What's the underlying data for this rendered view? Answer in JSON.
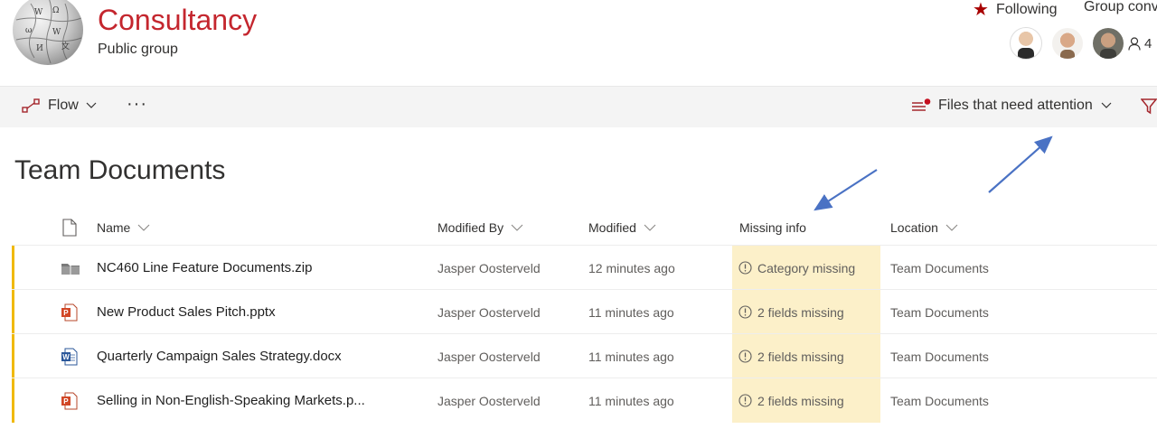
{
  "site": {
    "title": "Consultancy",
    "subtitle": "Public group",
    "following_label": "Following",
    "group_conversations_label": "Group conve",
    "member_count": "4"
  },
  "commandbar": {
    "flow_label": "Flow",
    "more_label": "···",
    "view_label": "Files that need attention"
  },
  "library": {
    "title": "Team Documents",
    "columns": {
      "name": "Name",
      "modified_by": "Modified By",
      "modified": "Modified",
      "missing_info": "Missing info",
      "location": "Location"
    },
    "rows": [
      {
        "icon": "zip-file-icon",
        "name": "NC460 Line Feature Documents.zip",
        "modified_by": "Jasper Oosterveld",
        "modified": "12 minutes ago",
        "missing": "Category missing",
        "location": "Team Documents"
      },
      {
        "icon": "powerpoint-file-icon",
        "name": "New Product Sales Pitch.pptx",
        "modified_by": "Jasper Oosterveld",
        "modified": "11 minutes ago",
        "missing": "2 fields missing",
        "location": "Team Documents"
      },
      {
        "icon": "word-file-icon",
        "name": "Quarterly Campaign Sales Strategy.docx",
        "modified_by": "Jasper Oosterveld",
        "modified": "11 minutes ago",
        "missing": "2 fields missing",
        "location": "Team Documents"
      },
      {
        "icon": "powerpoint-file-icon",
        "name": "Selling in Non-English-Speaking Markets.p...",
        "modified_by": "Jasper Oosterveld",
        "modified": "11 minutes ago",
        "missing": "2 fields missing",
        "location": "Team Documents"
      }
    ]
  },
  "colors": {
    "brand": "#c4262e",
    "missing_highlight": "#fcf0c9",
    "row_marker": "#f0b90b",
    "annotation_arrow": "#4a72c4"
  }
}
